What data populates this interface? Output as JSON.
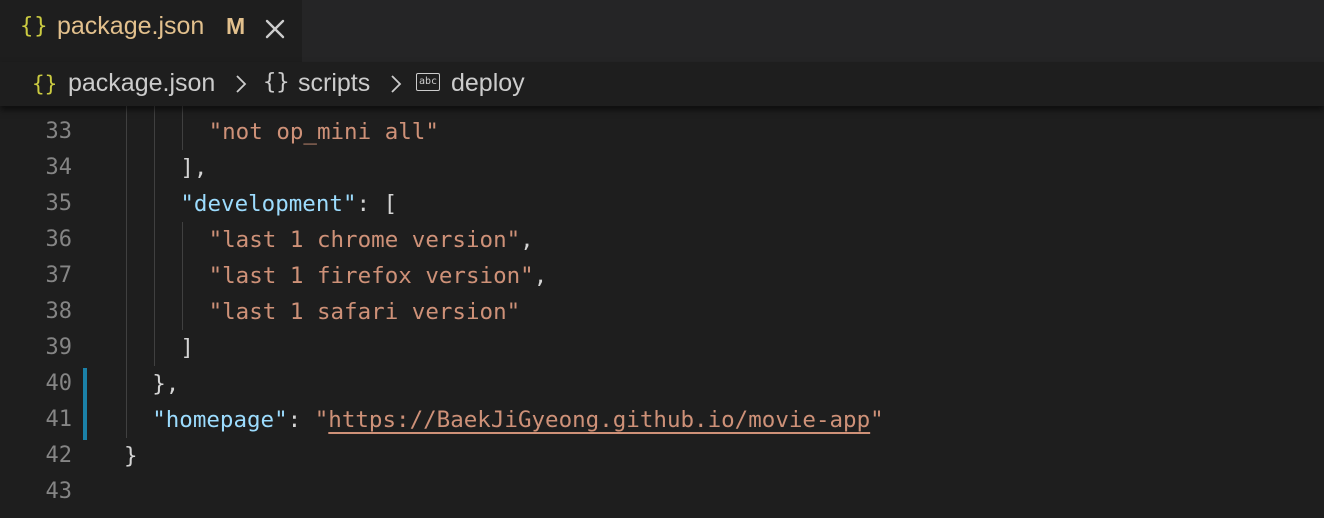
{
  "tab": {
    "icon": "{}",
    "title": "package.json",
    "modified": "M",
    "close_icon": "close-icon"
  },
  "breadcrumb": {
    "file_icon": "{}",
    "file": "package.json",
    "obj_icon": "{}",
    "scripts": "scripts",
    "deploy_icon": "abc",
    "deploy": "deploy"
  },
  "editor": {
    "lines": [
      {
        "n": "33",
        "tokens": [
          {
            "t": "str",
            "v": "\"not op_mini all\""
          }
        ],
        "indent": 6
      },
      {
        "n": "34",
        "tokens": [
          {
            "t": "punc",
            "v": "],"
          }
        ],
        "indent": 4
      },
      {
        "n": "35",
        "tokens": [
          {
            "t": "key",
            "v": "\"development\""
          },
          {
            "t": "punc",
            "v": ": ["
          }
        ],
        "indent": 4
      },
      {
        "n": "36",
        "tokens": [
          {
            "t": "str",
            "v": "\"last 1 chrome version\""
          },
          {
            "t": "punc",
            "v": ","
          }
        ],
        "indent": 6
      },
      {
        "n": "37",
        "tokens": [
          {
            "t": "str",
            "v": "\"last 1 firefox version\""
          },
          {
            "t": "punc",
            "v": ","
          }
        ],
        "indent": 6
      },
      {
        "n": "38",
        "tokens": [
          {
            "t": "str",
            "v": "\"last 1 safari version\""
          }
        ],
        "indent": 6
      },
      {
        "n": "39",
        "tokens": [
          {
            "t": "punc",
            "v": "]"
          }
        ],
        "indent": 4
      },
      {
        "n": "40",
        "tokens": [
          {
            "t": "punc",
            "v": "},"
          }
        ],
        "indent": 2
      },
      {
        "n": "41",
        "tokens": [
          {
            "t": "key",
            "v": "\"homepage\""
          },
          {
            "t": "punc",
            "v": ": "
          },
          {
            "t": "str",
            "v": "\""
          },
          {
            "t": "link",
            "v": "https://BaekJiGyeong.github.io/movie-app"
          },
          {
            "t": "str",
            "v": "\""
          }
        ],
        "indent": 2
      },
      {
        "n": "42",
        "tokens": [
          {
            "t": "punc",
            "v": "}"
          }
        ],
        "indent": 0
      },
      {
        "n": "43",
        "tokens": [],
        "indent": 0
      }
    ]
  },
  "colors": {
    "background": "#1e1e1e",
    "key": "#9cdcfe",
    "string": "#ce9178",
    "line_number": "#858585",
    "modified_gutter": "#1b81a8",
    "tab_title": "#e2c08d"
  }
}
